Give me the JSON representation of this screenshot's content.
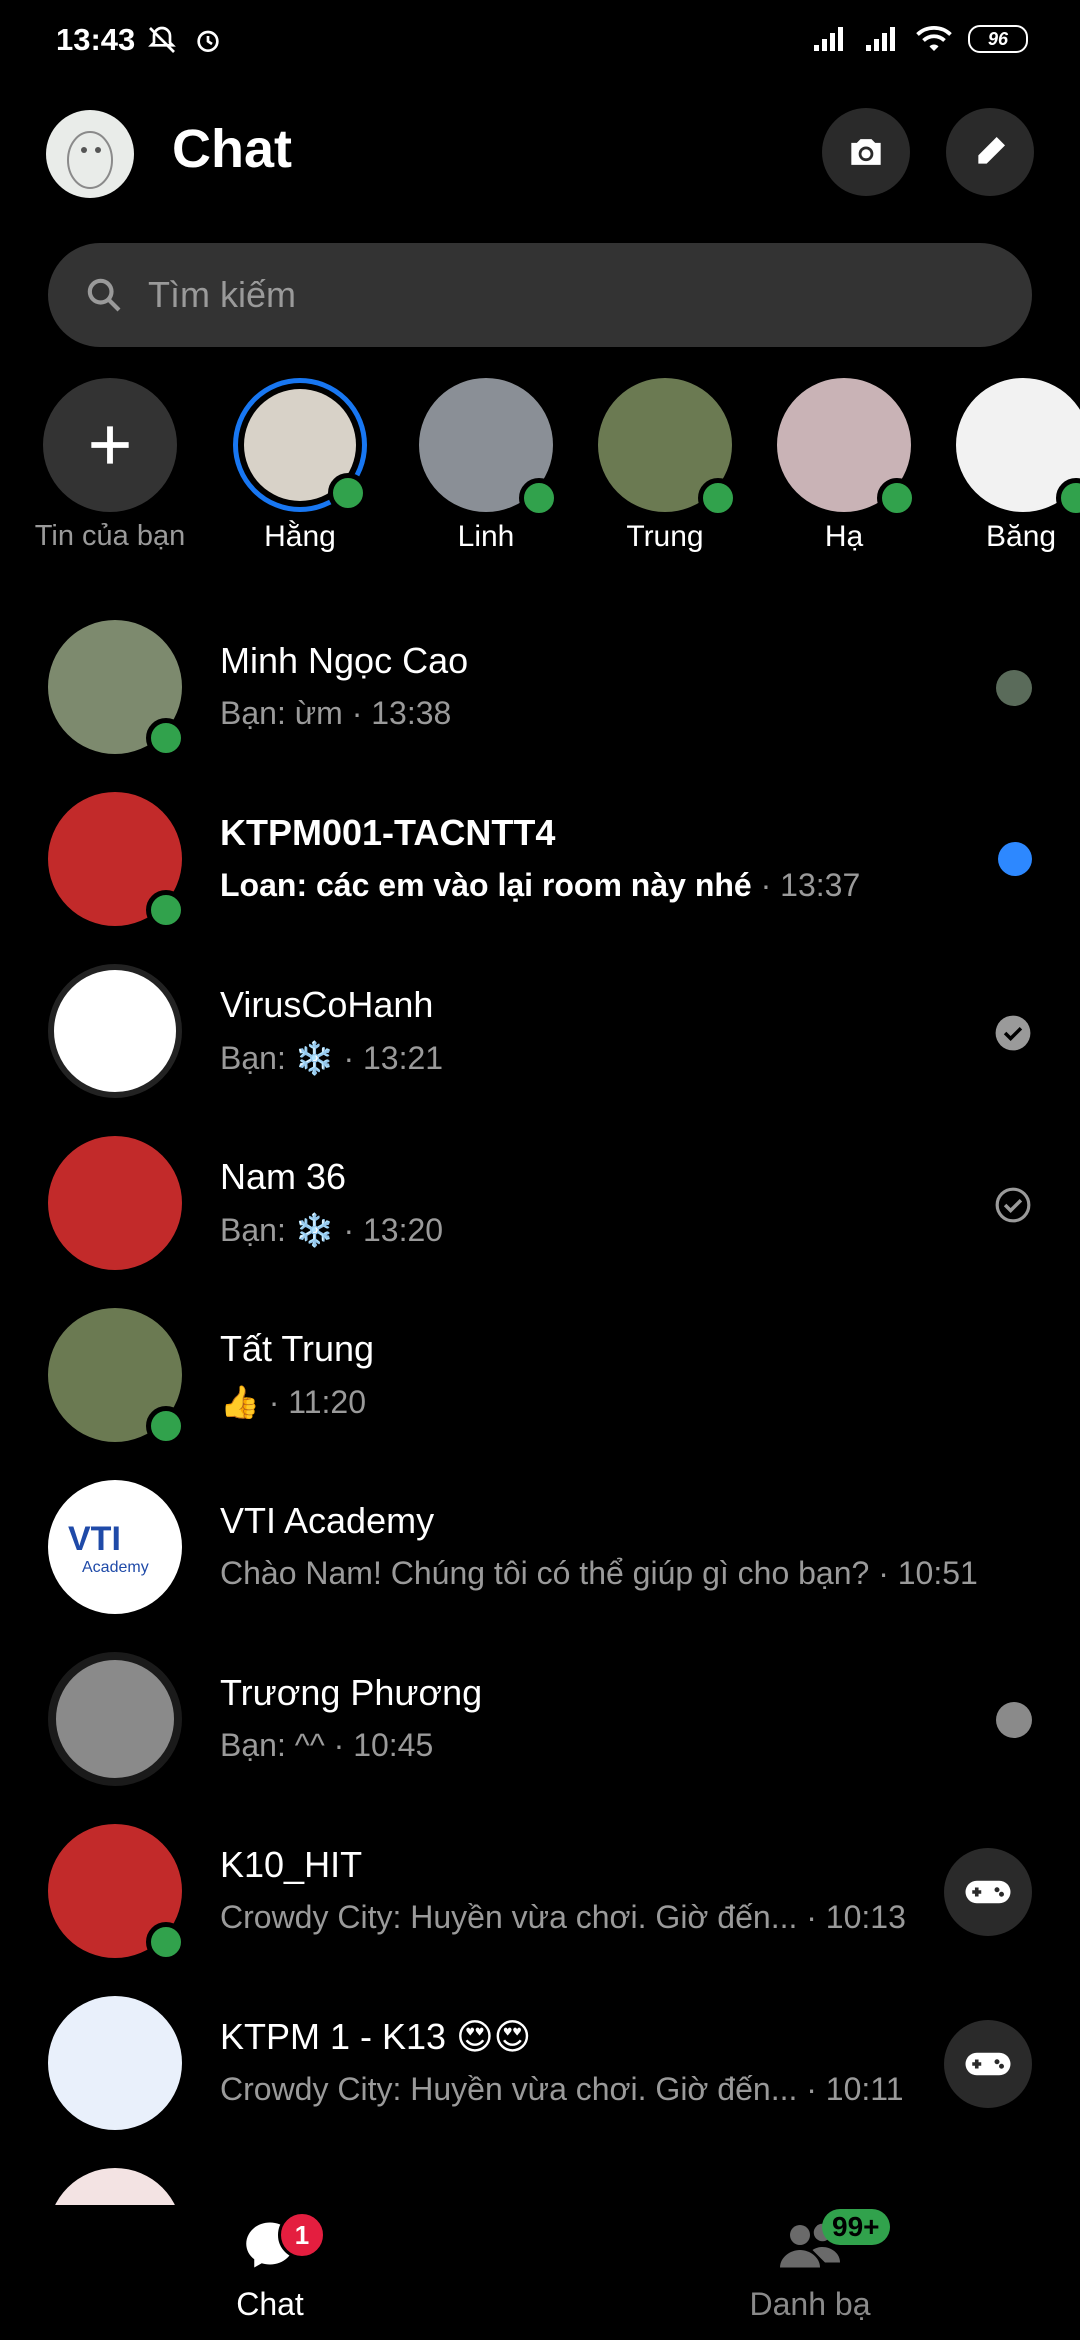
{
  "status_bar": {
    "time": "13:43",
    "battery": "96",
    "icons": [
      "mute-icon",
      "alarm-icon",
      "signal-icon",
      "signal-icon",
      "wifi-icon",
      "battery-icon"
    ]
  },
  "header": {
    "title": "Chat",
    "camera_icon": "camera-icon",
    "edit_icon": "pencil-icon"
  },
  "search": {
    "placeholder": "Tìm kiếm"
  },
  "stories": [
    {
      "label": "Tin của bạn",
      "type": "add"
    },
    {
      "label": "Hằng",
      "online": true,
      "active_story": true,
      "color": "#d8d2c8"
    },
    {
      "label": "Linh",
      "online": true,
      "color": "#8a8f96"
    },
    {
      "label": "Trung",
      "online": true,
      "color": "#6b7a52"
    },
    {
      "label": "Hạ",
      "online": true,
      "color": "#c9b3b6"
    },
    {
      "label": "Băng",
      "online": true,
      "color": "#f2f2f2"
    }
  ],
  "chats": [
    {
      "name": "Minh Ngọc Cao",
      "preview": "Bạn: ừm",
      "time": "13:38",
      "online": true,
      "status": "seen-avatar"
    },
    {
      "name": "KTPM001-TACNTT4",
      "preview": "Loan: các em vào lại room này nhé",
      "time": "13:37",
      "online": true,
      "unread": true,
      "status": "unread-dot"
    },
    {
      "name": "VirusCoHanh",
      "preview": "Bạn: ❄️",
      "time": "13:21",
      "status": "delivered-check"
    },
    {
      "name": "Nam 36",
      "preview": "Bạn: ❄️",
      "time": "13:20",
      "status": "sent-check"
    },
    {
      "name": "Tất Trung",
      "preview": "👍",
      "time": "11:20",
      "online": true,
      "status": "none"
    },
    {
      "name": "VTI Academy",
      "preview": "Chào Nam! Chúng tôi có thể giúp gì cho bạn?",
      "time": "10:51",
      "status": "none"
    },
    {
      "name": "Trương Phương",
      "preview": "Bạn: ^^",
      "time": "10:45",
      "status": "seen-avatar-grey"
    },
    {
      "name": "K10_HIT",
      "preview": "Crowdy City: Huyền vừa chơi. Giờ đến...",
      "time": "10:13",
      "online": true,
      "status": "game"
    },
    {
      "name": "KTPM 1 - K13 😍😍",
      "preview": "Crowdy City: Huyền vừa chơi. Giờ đến...",
      "time": "10:11",
      "status": "game"
    }
  ],
  "bottom_nav": {
    "chat_label": "Chat",
    "chat_badge": "1",
    "contacts_label": "Danh bạ",
    "contacts_badge": "99+"
  },
  "colors": {
    "background": "#000000",
    "accent": "#1877f2",
    "online": "#31a24c",
    "badge": "#e41e3f"
  }
}
